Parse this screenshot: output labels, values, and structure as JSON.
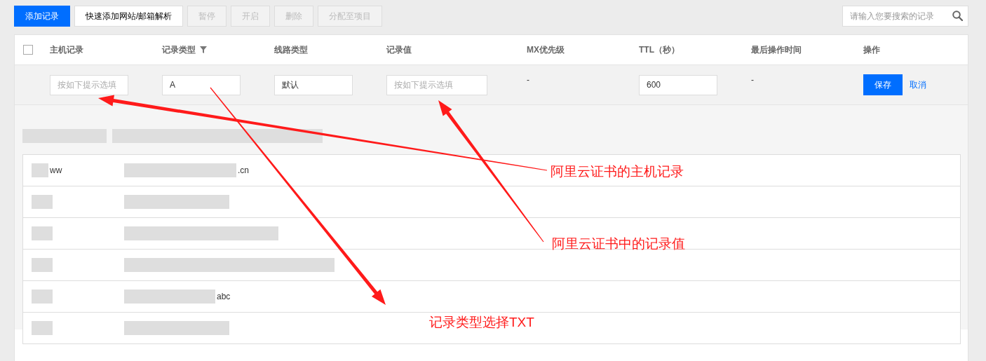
{
  "toolbar": {
    "buttons": [
      {
        "label": "添加记录",
        "kind": "primary",
        "disabled": false
      },
      {
        "label": "快速添加网站/邮箱解析",
        "kind": "default",
        "disabled": false
      },
      {
        "label": "暂停",
        "kind": "default",
        "disabled": true
      },
      {
        "label": "开启",
        "kind": "default",
        "disabled": true
      },
      {
        "label": "删除",
        "kind": "default",
        "disabled": true
      },
      {
        "label": "分配至项目",
        "kind": "default",
        "disabled": true
      }
    ],
    "search": {
      "placeholder": "请输入您要搜索的记录"
    }
  },
  "table": {
    "select_all": {
      "checked": false
    },
    "columns": [
      {
        "label": "主机记录",
        "kind": "plain"
      },
      {
        "label": "记录类型",
        "kind": "filterable"
      },
      {
        "label": "线路类型",
        "kind": "plain"
      },
      {
        "label": "记录值",
        "kind": "plain"
      },
      {
        "label": "MX优先级",
        "kind": "plain"
      },
      {
        "label": "TTL（秒）",
        "kind": "plain"
      },
      {
        "label": "最后操作时间",
        "kind": "plain"
      },
      {
        "label": "操作",
        "kind": "plain"
      }
    ],
    "edit_row": [
      {
        "kind": "input",
        "placeholder": "按如下提示选填"
      },
      {
        "kind": "input",
        "value": "A"
      },
      {
        "kind": "input",
        "value": "默认"
      },
      {
        "kind": "input",
        "placeholder": "按如下提示选填"
      },
      {
        "kind": "text",
        "value": "-"
      },
      {
        "kind": "input",
        "value": "600"
      },
      {
        "kind": "text",
        "value": "-"
      },
      {
        "kind": "actions",
        "save": "保存",
        "cancel": "取消"
      }
    ]
  },
  "hint_rows": [
    {
      "fragment_1": "ww",
      "fragment_2": ".cn"
    },
    {},
    {},
    {},
    {
      "fragment_2": "abc"
    },
    {}
  ],
  "annotations": [
    {
      "label": "阿里云证书的主机记录"
    },
    {
      "label": "阿里云证书中的记录值"
    },
    {
      "label": "记录类型选择TXT"
    }
  ]
}
